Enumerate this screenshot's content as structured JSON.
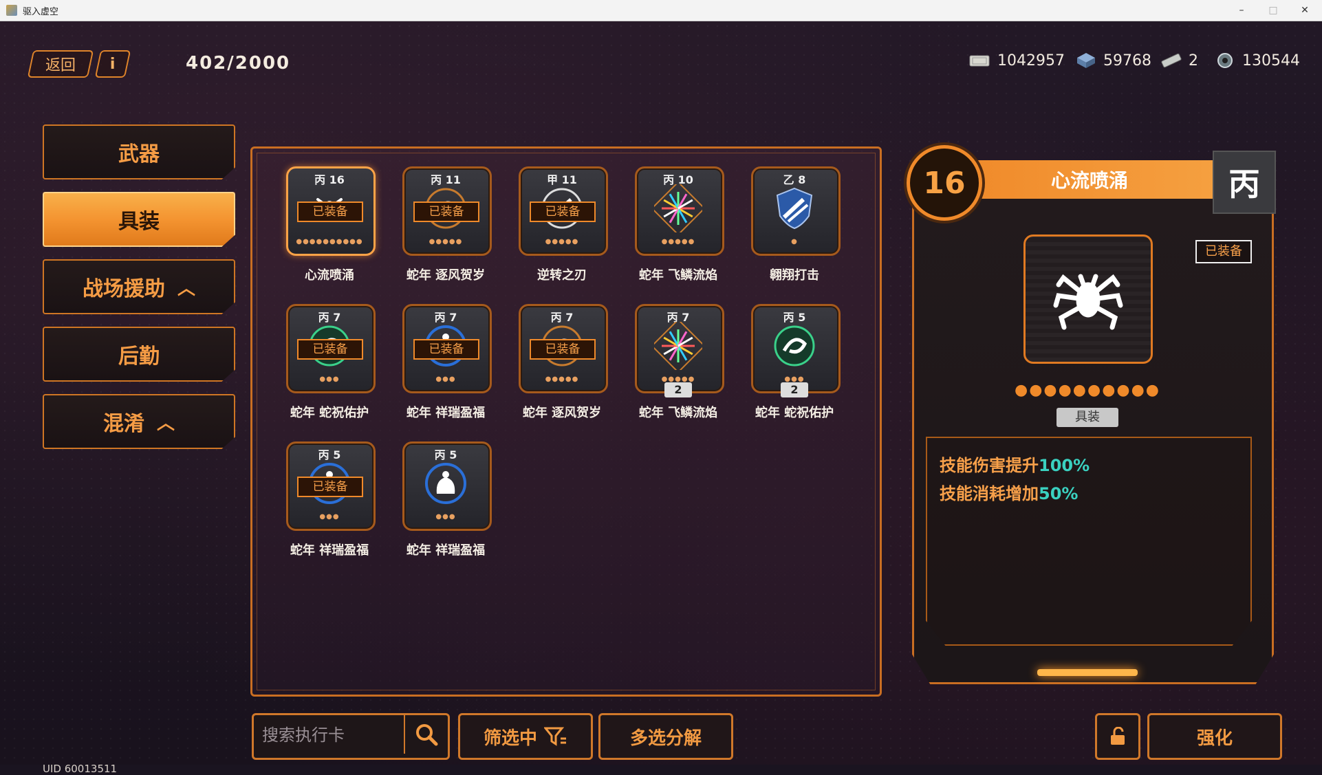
{
  "window": {
    "title": "驱入虚空",
    "controls": [
      "–",
      "□",
      "✕"
    ]
  },
  "top": {
    "back_label": "返回",
    "info_label": "i",
    "capacity": "402/2000"
  },
  "resources": [
    {
      "icon": "cash-icon",
      "value": "1042957"
    },
    {
      "icon": "crystal-icon",
      "value": "59768"
    },
    {
      "icon": "ticket-icon",
      "value": "2"
    },
    {
      "icon": "gear-part-icon",
      "value": "130544"
    }
  ],
  "sidebar": {
    "items": [
      {
        "label": "武器",
        "active": false,
        "chevron": ""
      },
      {
        "label": "具装",
        "active": true,
        "chevron": ""
      },
      {
        "label": "战场援助",
        "active": false,
        "chevron": "︿"
      },
      {
        "label": "后勤",
        "active": false,
        "chevron": ""
      },
      {
        "label": "混淆",
        "active": false,
        "chevron": "︿"
      }
    ]
  },
  "equipped_label": "已装备",
  "cards": [
    {
      "grade": "丙",
      "level": "16",
      "name": "心流喷涌",
      "equipped": true,
      "dots": "●●●●●●●●●●",
      "count": "",
      "art": "spider",
      "selected": true
    },
    {
      "grade": "丙",
      "level": "11",
      "name": "蛇年 逐风贺岁",
      "equipped": true,
      "dots": "●●●●●",
      "count": "",
      "art": "snake",
      "selected": false
    },
    {
      "grade": "甲",
      "level": "11",
      "name": "逆转之刃",
      "equipped": true,
      "dots": "●●●●●",
      "count": "",
      "art": "blade",
      "selected": false
    },
    {
      "grade": "丙",
      "level": "10",
      "name": "蛇年 飞鳞流焰",
      "equipped": false,
      "dots": "●●●●●",
      "count": "",
      "art": "firework",
      "selected": false
    },
    {
      "grade": "乙",
      "level": "8",
      "name": "翱翔打击",
      "equipped": false,
      "dots": "●",
      "count": "",
      "art": "missile",
      "selected": false
    },
    {
      "grade": "丙",
      "level": "7",
      "name": "蛇年 蛇祝佑护",
      "equipped": true,
      "dots": "●●●",
      "count": "",
      "art": "snake-green",
      "selected": false
    },
    {
      "grade": "丙",
      "level": "7",
      "name": "蛇年 祥瑞盈福",
      "equipped": true,
      "dots": "●●●",
      "count": "",
      "art": "bag",
      "selected": false
    },
    {
      "grade": "丙",
      "level": "7",
      "name": "蛇年 逐风贺岁",
      "equipped": true,
      "dots": "●●●●●",
      "count": "",
      "art": "snake",
      "selected": false
    },
    {
      "grade": "丙",
      "level": "7",
      "name": "蛇年 飞鳞流焰",
      "equipped": false,
      "dots": "●●●●●",
      "count": "2",
      "art": "firework",
      "selected": false
    },
    {
      "grade": "丙",
      "level": "5",
      "name": "蛇年 蛇祝佑护",
      "equipped": false,
      "dots": "●●●",
      "count": "2",
      "art": "snake-green",
      "selected": false
    },
    {
      "grade": "丙",
      "level": "5",
      "name": "蛇年 祥瑞盈福",
      "equipped": true,
      "dots": "●●●",
      "count": "",
      "art": "bag",
      "selected": false
    },
    {
      "grade": "丙",
      "level": "5",
      "name": "蛇年 祥瑞盈福",
      "equipped": false,
      "dots": "●●●",
      "count": "",
      "art": "bag",
      "selected": false
    }
  ],
  "detail": {
    "level": "16",
    "name": "心流喷涌",
    "grade": "丙",
    "equipped_label": "已装备",
    "dots": "●●●●●●●●●●",
    "tag": "具装",
    "effects": [
      {
        "text": "技能伤害提升",
        "value": "100%"
      },
      {
        "text": "技能消耗增加",
        "value": "50%"
      }
    ]
  },
  "bottom": {
    "search_placeholder": "搜索执行卡",
    "filter_label": "筛选中",
    "multi_label": "多选分解",
    "upgrade_label": "强化",
    "uid": "UID 60013511"
  },
  "colors": {
    "accent": "#f08a2a",
    "teal": "#3ad1c0",
    "bg": "#1a1420"
  }
}
